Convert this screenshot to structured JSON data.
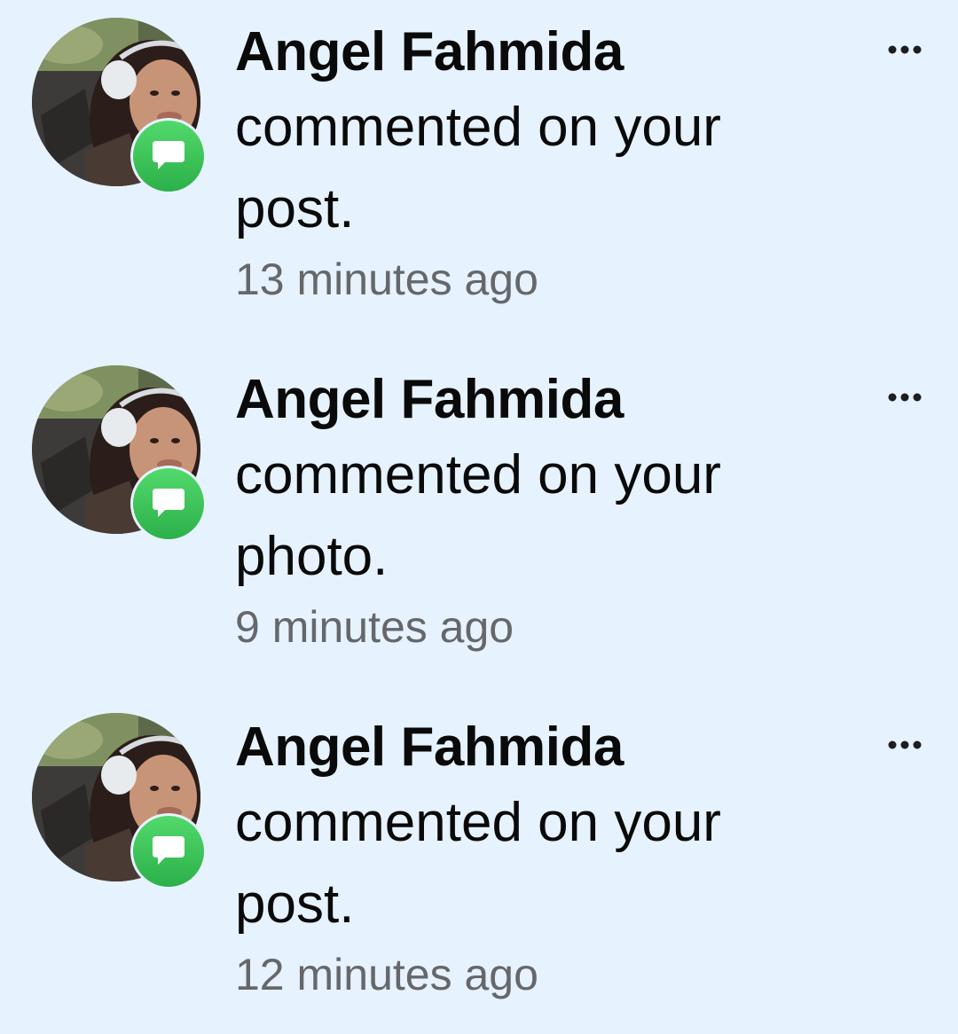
{
  "notifications": [
    {
      "name": "Angel Fahmida",
      "message": "commented on your post.",
      "time": "13 minutes ago",
      "avatar_icon": "profile-photo",
      "badge_icon": "comment-bubble-icon",
      "more_icon": "more-options-icon"
    },
    {
      "name": "Angel Fahmida",
      "message": "commented on your photo.",
      "time": "9 minutes ago",
      "avatar_icon": "profile-photo",
      "badge_icon": "comment-bubble-icon",
      "more_icon": "more-options-icon"
    },
    {
      "name": "Angel Fahmida",
      "message": "commented on your post.",
      "time": "12 minutes ago",
      "avatar_icon": "profile-photo",
      "badge_icon": "comment-bubble-icon",
      "more_icon": "more-options-icon"
    }
  ],
  "colors": {
    "background": "#e6f2fd",
    "name_text": "#0a0a0a",
    "time_text": "#65676b",
    "badge_green": "#2cb04a"
  }
}
